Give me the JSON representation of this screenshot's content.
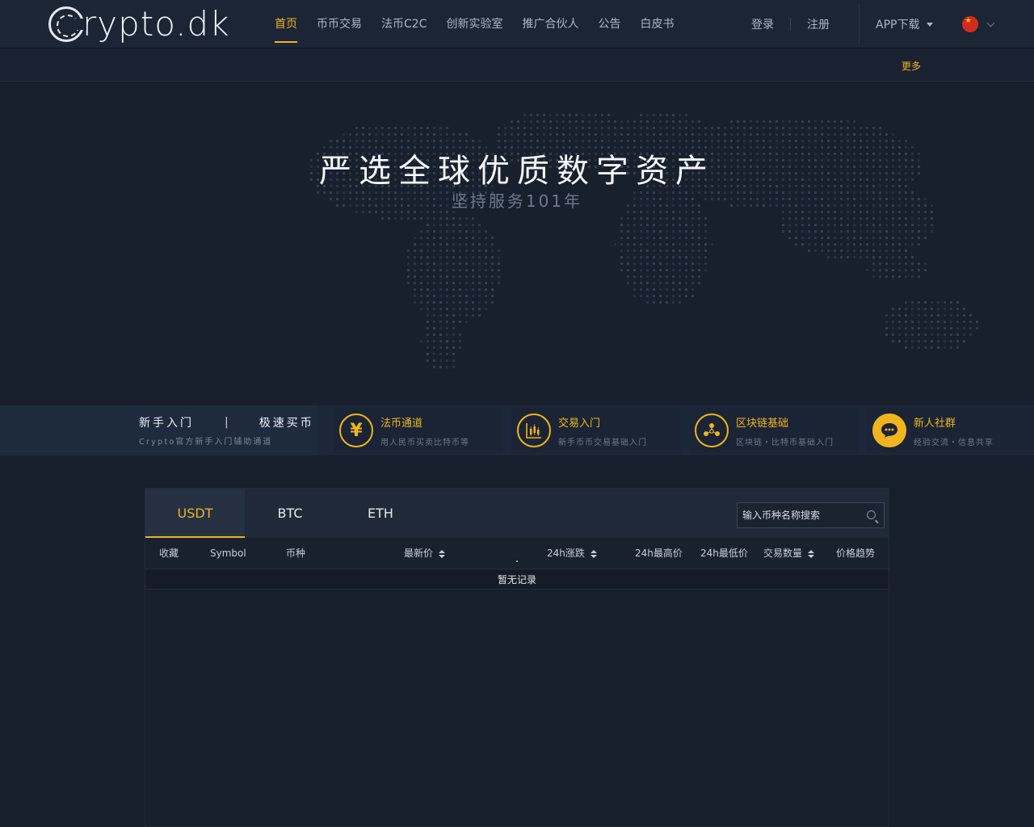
{
  "header": {
    "logo_text": "rypto.dk",
    "nav": [
      {
        "label": "首页",
        "active": true
      },
      {
        "label": "币币交易",
        "active": false
      },
      {
        "label": "法币C2C",
        "active": false
      },
      {
        "label": "创新实验室",
        "active": false
      },
      {
        "label": "推广合伙人",
        "active": false
      },
      {
        "label": "公告",
        "active": false
      },
      {
        "label": "白皮书",
        "active": false
      }
    ],
    "login": "登录",
    "register": "注册",
    "app_download": "APP下载",
    "language_flag": "china-flag-icon"
  },
  "notice": {
    "more": "更多"
  },
  "hero": {
    "title": "严选全球优质数字资产",
    "subtitle": "坚持服务101年"
  },
  "guide": {
    "beginner": "新手入门",
    "separator": "|",
    "quick_buy": "极速买币",
    "desc": "Crypto官方新手入门辅助通道"
  },
  "quick_links": [
    {
      "title": "法币通道",
      "desc": "用人民币买卖比特币等",
      "icon": "yen-icon"
    },
    {
      "title": "交易入门",
      "desc": "新手币币交易基础入门",
      "icon": "candlestick-chart-icon"
    },
    {
      "title": "区块链基础",
      "desc": "区块链・比特币基础入门",
      "icon": "blockchain-icon"
    },
    {
      "title": "新人社群",
      "desc": "经验交流・信息共享",
      "icon": "chat-bubble-icon"
    }
  ],
  "market": {
    "tabs": [
      {
        "label": "USDT",
        "active": true
      },
      {
        "label": "BTC",
        "active": false
      },
      {
        "label": "ETH",
        "active": false
      }
    ],
    "search_placeholder": "输入币种名称搜索",
    "columns": {
      "favorite": "收藏",
      "symbol": "Symbol",
      "coin": "币种",
      "last_price": "最新价",
      "change_24h": "24h涨跌",
      "high_24h": "24h最高价",
      "low_24h": "24h最低价",
      "volume": "交易数量",
      "trend": "价格趋势"
    },
    "empty_text": "暂无记录"
  },
  "colors": {
    "accent": "#f0b41e",
    "background": "#171e2c",
    "header": "#1c2535"
  }
}
